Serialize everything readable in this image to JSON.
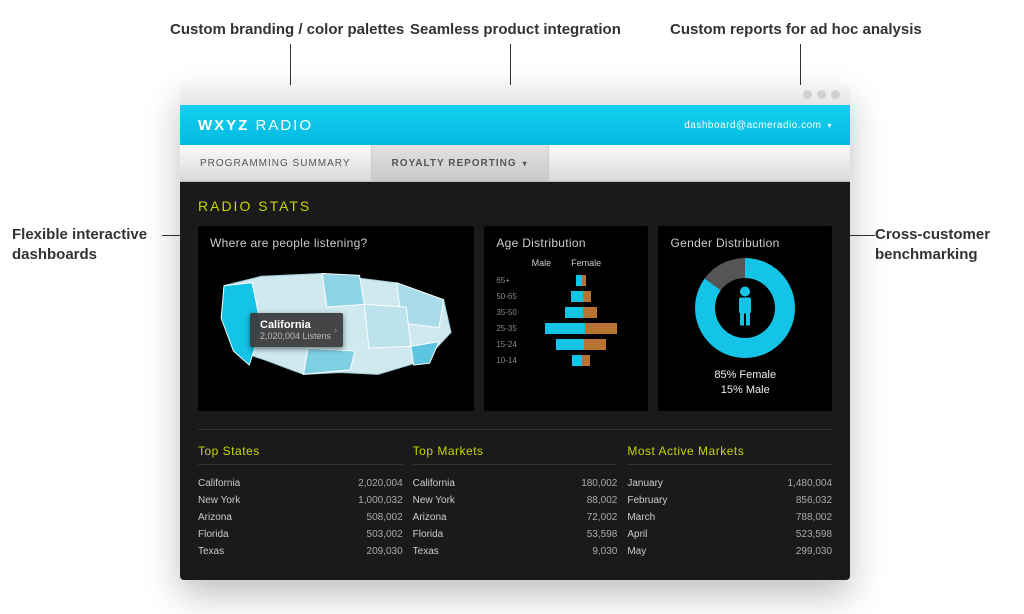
{
  "callouts": {
    "branding": "Custom branding / color palettes",
    "integration": "Seamless product integration",
    "reports": "Custom reports for ad hoc analysis",
    "dashboards": "Flexible interactive dashboards",
    "benchmarking": "Cross-customer benchmarking"
  },
  "header": {
    "brand_bold": "WXYZ",
    "brand_light": " RADIO",
    "user_email": "dashboard@acmeradio.com"
  },
  "tabs": {
    "programming": "PROGRAMMING SUMMARY",
    "royalty": "ROYALTY REPORTING"
  },
  "section_title": "RADIO STATS",
  "map": {
    "title": "Where are people listening?",
    "tooltip_state": "California",
    "tooltip_value": "2,020,004 Listens"
  },
  "age": {
    "title": "Age Distribution",
    "male_label": "Male",
    "female_label": "Female"
  },
  "gender": {
    "title": "Gender Distribution",
    "line1": "85% Female",
    "line2": "15% Male"
  },
  "tables": {
    "states_title": "Top States",
    "states": [
      {
        "name": "California",
        "value": "2,020,004"
      },
      {
        "name": "New York",
        "value": "1,000,032"
      },
      {
        "name": "Arizona",
        "value": "508,002"
      },
      {
        "name": "Florida",
        "value": "503,002"
      },
      {
        "name": "Texas",
        "value": "209,030"
      }
    ],
    "markets_title": "Top Markets",
    "markets": [
      {
        "name": "California",
        "value": "180,002"
      },
      {
        "name": "New York",
        "value": "88,002"
      },
      {
        "name": "Arizona",
        "value": "72,002"
      },
      {
        "name": "Florida",
        "value": "53,598"
      },
      {
        "name": "Texas",
        "value": "9,030"
      }
    ],
    "active_title": "Most Active Markets",
    "active": [
      {
        "name": "January",
        "value": "1,480,004"
      },
      {
        "name": "February",
        "value": "856,032"
      },
      {
        "name": "March",
        "value": "788,002"
      },
      {
        "name": "April",
        "value": "523,598"
      },
      {
        "name": "May",
        "value": "299,030"
      }
    ]
  },
  "chart_data": [
    {
      "type": "bar",
      "title": "Age Distribution",
      "categories": [
        "65+",
        "50-65",
        "35-50",
        "25-35",
        "15-24",
        "10-14"
      ],
      "series": [
        {
          "name": "Male",
          "values": [
            6,
            12,
            18,
            40,
            28,
            10
          ]
        },
        {
          "name": "Female",
          "values": [
            4,
            8,
            14,
            32,
            22,
            8
          ]
        }
      ],
      "note": "values are relative bar lengths in px (approx)"
    },
    {
      "type": "pie",
      "title": "Gender Distribution",
      "categories": [
        "Female",
        "Male"
      ],
      "values": [
        85,
        15
      ]
    },
    {
      "type": "table",
      "title": "Top States",
      "categories": [
        "California",
        "New York",
        "Arizona",
        "Florida",
        "Texas"
      ],
      "values": [
        2020004,
        1000032,
        508002,
        503002,
        209030
      ]
    },
    {
      "type": "table",
      "title": "Top Markets",
      "categories": [
        "California",
        "New York",
        "Arizona",
        "Florida",
        "Texas"
      ],
      "values": [
        180002,
        88002,
        72002,
        53598,
        9030
      ]
    },
    {
      "type": "table",
      "title": "Most Active Markets",
      "categories": [
        "January",
        "February",
        "March",
        "April",
        "May"
      ],
      "values": [
        1480004,
        856032,
        788002,
        523598,
        299030
      ]
    }
  ]
}
